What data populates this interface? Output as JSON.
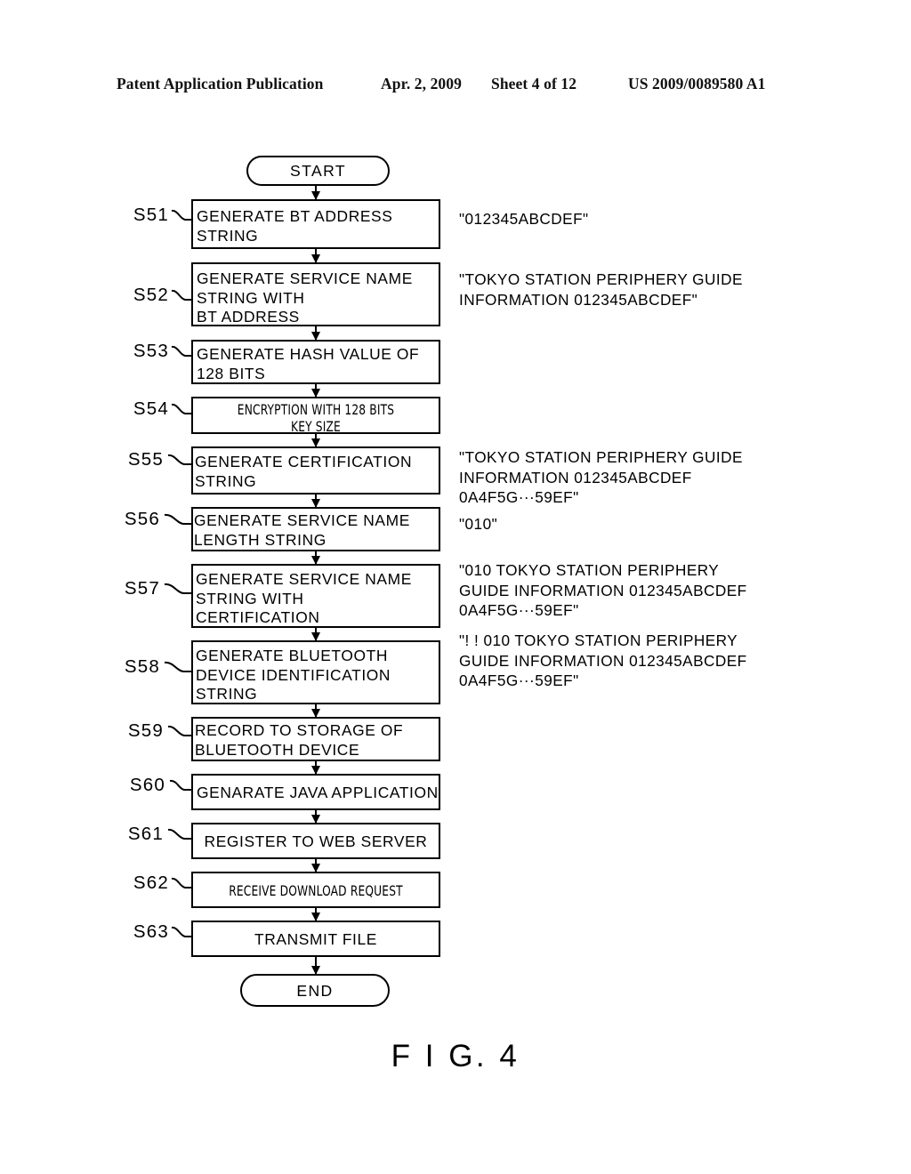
{
  "header": {
    "publication": "Patent Application Publication",
    "date": "Apr. 2, 2009",
    "sheet": "Sheet 4 of 12",
    "patent_number": "US 2009/0089580 A1"
  },
  "figure": {
    "caption": "F I G. 4"
  },
  "flowchart": {
    "start_label": "START",
    "end_label": "END",
    "steps": [
      {
        "id": "S51",
        "text": "GENERATE BT ADDRESS\nSTRING"
      },
      {
        "id": "S52",
        "text": "GENERATE SERVICE NAME\nSTRING WITH\nBT ADDRESS"
      },
      {
        "id": "S53",
        "text": "GENERATE HASH VALUE OF\n128 BITS"
      },
      {
        "id": "S54",
        "text": "ENCRYPTION WITH 128 BITS\nKEY SIZE"
      },
      {
        "id": "S55",
        "text": "GENERATE CERTIFICATION\nSTRING"
      },
      {
        "id": "S56",
        "text": "GENERATE SERVICE NAME\nLENGTH STRING"
      },
      {
        "id": "S57",
        "text": "GENERATE SERVICE NAME\nSTRING WITH\nCERTIFICATION"
      },
      {
        "id": "S58",
        "text": "GENERATE BLUETOOTH\nDEVICE IDENTIFICATION\nSTRING"
      },
      {
        "id": "S59",
        "text": "RECORD TO STORAGE OF\nBLUETOOTH DEVICE"
      },
      {
        "id": "S60",
        "text": "GENARATE JAVA APPLICATION"
      },
      {
        "id": "S61",
        "text": "REGISTER TO WEB SERVER"
      },
      {
        "id": "S62",
        "text": "RECEIVE DOWNLOAD REQUEST"
      },
      {
        "id": "S63",
        "text": "TRANSMIT FILE"
      }
    ],
    "annotations": [
      {
        "for": "S51",
        "text": "\"012345ABCDEF\""
      },
      {
        "for": "S52",
        "text": "\"TOKYO STATION PERIPHERY GUIDE\nINFORMATION 012345ABCDEF\""
      },
      {
        "for": "S55",
        "text": "\"TOKYO STATION PERIPHERY GUIDE\nINFORMATION 012345ABCDEF\n0A4F5G···59EF\""
      },
      {
        "for": "S56",
        "text": "\"010\""
      },
      {
        "for": "S57",
        "text": "\"010 TOKYO STATION PERIPHERY\nGUIDE INFORMATION 012345ABCDEF\n0A4F5G···59EF\""
      },
      {
        "for": "S58",
        "text": "\"! ! 010 TOKYO STATION PERIPHERY\nGUIDE INFORMATION 012345ABCDEF\n0A4F5G···59EF\""
      }
    ]
  }
}
